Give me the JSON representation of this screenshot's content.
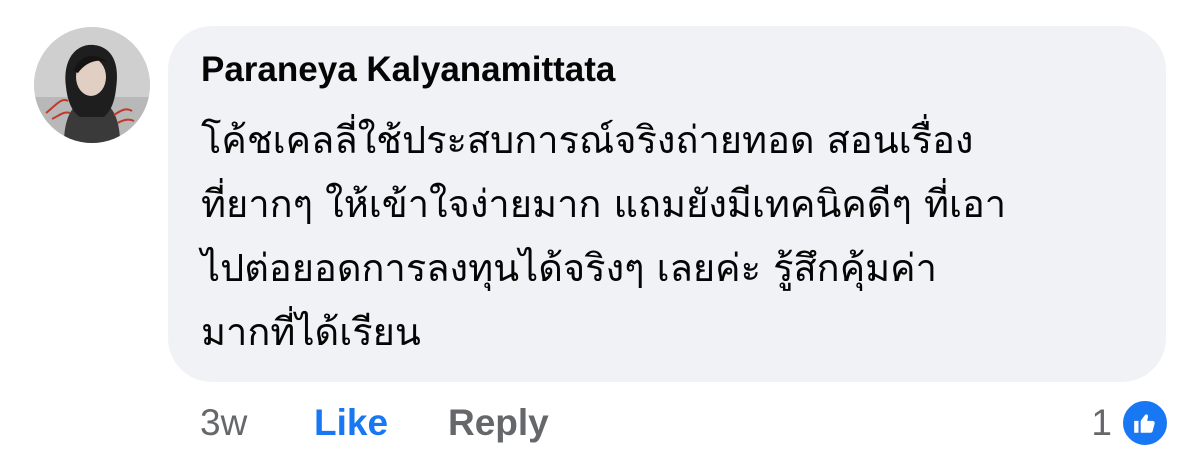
{
  "comment": {
    "author": "Paraneya Kalyanamittata",
    "text_lines": [
      "โค้ชเคลลี่ใช้ประสบการณ์จริงถ่ายทอด สอนเรื่อง",
      "ที่ยากๆ ให้เข้าใจง่ายมาก แถมยังมีเทคนิคดีๆ ที่เอา",
      "ไปต่อยอดการลงทุนได้จริงๆ เลยค่ะ รู้สึกคุ้มค่า",
      "มากที่ได้เรียน"
    ],
    "time": "3w",
    "like_label": "Like",
    "reply_label": "Reply",
    "reaction_count": "1",
    "reaction_icon": "thumbs-up-icon",
    "bubble_color": "#f0f2f5",
    "accent_color": "#1877f2"
  }
}
